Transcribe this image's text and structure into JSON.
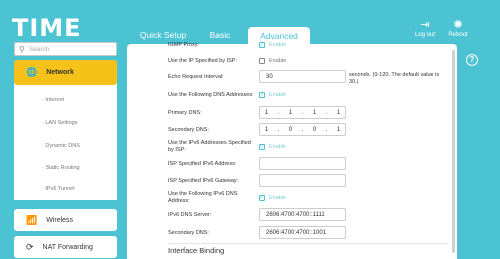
{
  "header": {
    "logo": "TIME",
    "tabs": {
      "quick": "Quick Setup",
      "basic": "Basic",
      "advanced": "Advanced"
    },
    "logout": "Log out",
    "reboot": "Reboot"
  },
  "sidebar": {
    "search_placeholder": "Search",
    "network": "Network",
    "network_items": [
      "Internet",
      "LAN Settings",
      "Dynamic DNS",
      "Static Routing",
      "IPv6 Tunnel"
    ],
    "wireless": "Wireless",
    "nat": "NAT Forwarding"
  },
  "form": {
    "igmp_proxy": {
      "label": "IGMP Proxy:",
      "cb": "Enable"
    },
    "use_ip_isp": {
      "label": "Use the IP Specified by ISP:",
      "cb": "Enable"
    },
    "echo": {
      "label": "Echo Request Interval:",
      "value": "30",
      "hint": "seconds. (0-120. The default value is 30.)"
    },
    "use_dns": {
      "label": "Use the Following DNS Addresses:",
      "cb": "Enable"
    },
    "primary_dns": {
      "label": "Primary DNS:",
      "octets": [
        "1",
        "1",
        "1",
        "1"
      ]
    },
    "secondary_dns": {
      "label": "Secondary DNS:",
      "octets": [
        "1",
        "0",
        "0",
        "1"
      ]
    },
    "use_ipv6_isp": {
      "label": "Use the IPv6 Addresses Specified by ISP:",
      "cb": "Enable"
    },
    "isp_ipv6": {
      "label": "ISP Specified IPv6 Address:",
      "value": ""
    },
    "isp_ipv6_gw": {
      "label": "ISP Specified IPv6 Gateway:",
      "value": ""
    },
    "use_ipv6_dns": {
      "label": "Use the Following IPv6 DNS Address:",
      "cb": "Enable"
    },
    "ipv6_dns": {
      "label": "IPv6 DNS Server:",
      "value": "2606:4700:4700::1111"
    },
    "secondary_dns6": {
      "label": "Secondary DNS:",
      "value": "2606:4700:4700::1001"
    },
    "section": "Interface Binding"
  },
  "colors": {
    "brand": "#4cc3d3",
    "accent": "#f6c21a"
  }
}
